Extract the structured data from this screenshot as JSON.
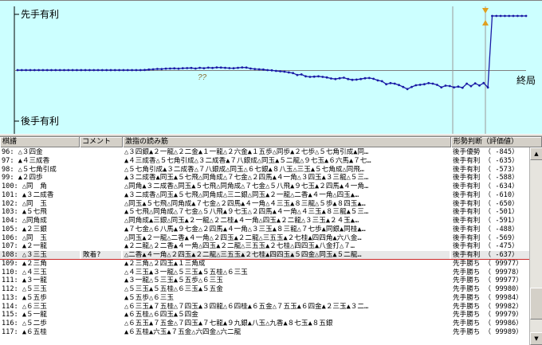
{
  "graph": {
    "top_label": "先手有利",
    "bottom_label": "後手有利",
    "end_label": "終局",
    "question_mark": "??",
    "colors": {
      "background": "#ccffff",
      "line": "#1a1aa6",
      "axis": "#000000",
      "cursor": "#8a8a8a",
      "marker": "#e0a020"
    },
    "eval_series": [
      0,
      0,
      0,
      0,
      0,
      0,
      0,
      0,
      0,
      0,
      0,
      0,
      0,
      0,
      0,
      0,
      0,
      0,
      0,
      0,
      0,
      0,
      0,
      0,
      0,
      0,
      0,
      0,
      0,
      0,
      5,
      20,
      30,
      45,
      40,
      55,
      60,
      65,
      55,
      70,
      75,
      80,
      60,
      85,
      70,
      90,
      80,
      100,
      95,
      85,
      75,
      70,
      85,
      100,
      95,
      60,
      40,
      30,
      20,
      0,
      -10,
      -30,
      -45,
      -60,
      -85,
      -110,
      -180,
      -160,
      -230,
      -250,
      -240,
      -230,
      -250,
      -270,
      -310,
      -330,
      -300,
      -280,
      -330,
      -360,
      -350,
      -330,
      -300,
      -290,
      -320,
      -380,
      -410,
      -520,
      -480,
      -500,
      -550,
      -620,
      -700,
      -620,
      -560,
      -540,
      -520,
      -480,
      -500,
      -545,
      -635,
      -573,
      -588,
      -634,
      -610,
      -650,
      -501,
      -591,
      -488,
      -569,
      -475,
      -637,
      9999,
      9999,
      9999,
      9999,
      9999,
      9999,
      9999,
      9999,
      9999
    ]
  },
  "table": {
    "columns": [
      "棋譜",
      "コメント",
      "激指の読み筋",
      "形勢判断（評価値）"
    ],
    "rows": [
      {
        "move": "96: △３四金",
        "comment": "",
        "sequence": "△３四銀▲２一龍△２二金▲１一龍△２六金▲１五歩△同歩▲２七歩△５七角引成▲同…",
        "eval": "後手優勢 （ -845）"
      },
      {
        "move": "97: ▲４三成香",
        "comment": "",
        "sequence": "▲４三成香△５七角引成△３二成香▲７八銀成△同玉▲５二龍△９七玉▲６六馬▲７七…",
        "eval": "後手有利 （ -635）"
      },
      {
        "move": "98: △５七角引成",
        "comment": "",
        "sequence": "△５七角引成▲３二成香△７八銀成△同玉△６七銀▲８八玉△三玉▲５七角成△同飛…",
        "eval": "後手有利 （ -573）"
      },
      {
        "move": "99: ▲２四歩",
        "comment": "",
        "sequence": "▲３二成香▲同玉▲５七飛△同角成△７七金△２四馬▲４一角△３四玉▲３三龍△５三…",
        "eval": "後手有利 （ -588）"
      },
      {
        "move": "100: △同　角",
        "comment": "",
        "sequence": "△同角▲３二成香△同玉▲５七飛△同角成△７七金△５八飛▲９七玉▲２四馬▲４一角…",
        "eval": "後手有利 （ -634）"
      },
      {
        "move": "101: ▲３二成香",
        "comment": "",
        "sequence": "▲３二成香△同玉▲５七飛△同角成△三二銀△同玉▲２一龍△二香▲４一角△四玉▲…",
        "eval": "後手有利 （ -610）"
      },
      {
        "move": "102: △同　玉",
        "comment": "",
        "sequence": "△同玉▲５七飛△同角成▲７七金△２四馬▲４一角△４三玉▲８三龍△５歩▲８四玉▲…",
        "eval": "後手有利 （ -650）"
      },
      {
        "move": "103: ▲５七飛",
        "comment": "",
        "sequence": "▲５七飛△同角成△７七金△５八飛▲９七玉△２四馬▲４一角△４三玉▲８三龍▲５三…",
        "eval": "後手有利 （ -501）"
      },
      {
        "move": "104: △同角成",
        "comment": "",
        "sequence": "△同角成▲三銀△同玉▲２一龍△２二桂▲４一角△四玉▲２二龍△３三玉▲２４玉▲…",
        "eval": "後手有利 （ -591）"
      },
      {
        "move": "105: ▲２三銀",
        "comment": "",
        "sequence": "▲７七金△６八馬▲９七金△２四馬▲４一角△３三玉▲８三龍△７七歩▲同銀▲同桂▲…",
        "eval": "後手有利 （ -488）"
      },
      {
        "move": "106: △同　玉",
        "comment": "",
        "sequence": "△同玉▲２一龍△二香▲４一角△２四玉▲２二龍△三五玉▲２七桂▲四四角▲六八金…",
        "eval": "後手有利 （ -569）"
      },
      {
        "move": "107: ▲２一龍",
        "comment": "",
        "sequence": "▲２二龍△２二香▲４一角△四玉▲２二龍△三五玉▲２七桂△四四玉▲八金打△７…",
        "eval": "後手有利 （ -475）"
      },
      {
        "move": "108: △３三玉",
        "comment": "敗着?",
        "sequence": "△二香▲４一角△２四玉▲２二龍△三五玉▲２七桂▲四四玉▲５四金△同玉▲５二龍…",
        "eval": "後手有利 （ -637）"
      },
      {
        "move": "109: ▲２三角",
        "comment": "",
        "sequence": "▲２三角△２四玉▲１三角成",
        "eval": "先手勝ち （ 99977）"
      },
      {
        "move": "110: △４三玉",
        "comment": "",
        "sequence": "△４三玉▲３一龍△５三玉▲５五桂△６三玉",
        "eval": "先手勝ち （ 99978）"
      },
      {
        "move": "111: ▲３一龍",
        "comment": "",
        "sequence": "▲３一龍△５三玉▲５五歩△６三玉",
        "eval": "先手勝ち （ 99977）"
      },
      {
        "move": "112: △５三玉",
        "comment": "",
        "sequence": "△５三玉▲５五桂△６三玉▲５五金",
        "eval": "先手勝ち （ 99980）"
      },
      {
        "move": "113: ▲５五歩",
        "comment": "",
        "sequence": "▲５五歩△６三玉",
        "eval": "先手勝ち （ 99984）"
      },
      {
        "move": "114: △６三玉",
        "comment": "",
        "sequence": "△６三玉▲７五桂△７四玉▲３四龍△６四桂▲６五金△７五玉▲６四金▲２三玉▲３二…",
        "eval": "先手勝ち （ 99982）"
      },
      {
        "move": "115: ▲５一龍",
        "comment": "",
        "sequence": "▲６五桂△６四玉▲５四金",
        "eval": "先手勝ち （ 99979）"
      },
      {
        "move": "116: △５二歩",
        "comment": "",
        "sequence": "△６五玉▲７五金△７四玉▲７七龍▲９九銀▲八玉△九香▲８七玉▲８五銀",
        "eval": "先手勝ち （ 99986）"
      },
      {
        "move": "117: ▲６五桂",
        "comment": "",
        "sequence": "▲６五桂▲六玉▲７五金△六四金△六二龍",
        "eval": "先手勝ち （ 99989）"
      }
    ],
    "selected_row_index": 12
  },
  "scrollbar": {
    "up_arrow": "▲",
    "down_arrow": "▼"
  }
}
